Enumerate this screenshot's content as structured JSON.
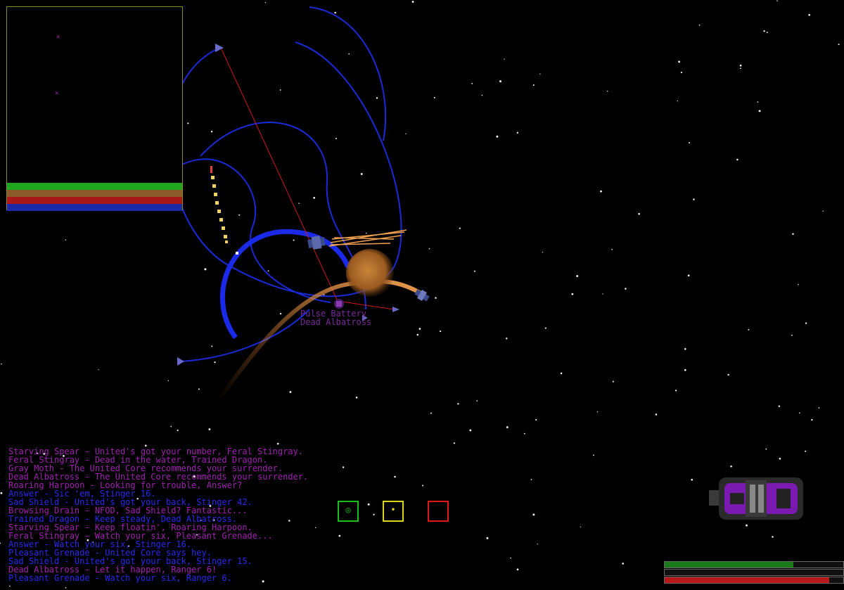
{
  "target": {
    "name": "Pulse Battery",
    "owner": "Dead Albatross"
  },
  "minimap": {
    "bar_colors": [
      "#1fa51f",
      "#8a5a2a",
      "#a81818",
      "#1c2aa8"
    ]
  },
  "chat": [
    {
      "text": "Starving Spear - United's got your number, Feral Stingray.",
      "color": "#a020b0"
    },
    {
      "text": "Feral Stingray - Dead in the water, Trained Dragon.",
      "color": "#a020b0"
    },
    {
      "text": "Gray Moth - The United Core recommends your surrender.",
      "color": "#a020b0"
    },
    {
      "text": "Dead Albatross - The United Core recommends your surrender.",
      "color": "#a020b0"
    },
    {
      "text": "Roaring Harpoon - Looking for trouble, Answer?",
      "color": "#a020b0"
    },
    {
      "text": "Answer - Sic 'em, Stinger 16.",
      "color": "#2a2af0"
    },
    {
      "text": "Sad Shield - United's got your back, Stinger 42.",
      "color": "#2a2af0"
    },
    {
      "text": "Browsing Drain - NFOD, Sad Shield? Fantastic...",
      "color": "#a020b0"
    },
    {
      "text": "Trained Dragon - Keep steady, Dead Albatross.",
      "color": "#2a2af0"
    },
    {
      "text": "Starving Spear - Keep floatin', Roaring Harpoon.",
      "color": "#a020b0"
    },
    {
      "text": "Feral Stingray - Watch your six, Pleasant Grenade...",
      "color": "#a020b0"
    },
    {
      "text": "Answer - Watch your six, Stinger 16.",
      "color": "#2a2af0"
    },
    {
      "text": "Pleasant Grenade - United Core says hey.",
      "color": "#2a2af0"
    },
    {
      "text": "Sad Shield - United's got your back, Stinger 15.",
      "color": "#2a2af0"
    },
    {
      "text": "Dead Albatross - Let it happen, Ranger 6!",
      "color": "#a020b0"
    },
    {
      "text": "Pleasant Grenade - Watch your six, Ranger 6.",
      "color": "#2a2af0"
    }
  ],
  "weapon_slots": [
    {
      "icon": "gun-turret-icon",
      "color": "#18c018",
      "mark": "◎"
    },
    {
      "icon": "missile-launcher-icon",
      "color": "#d8d818",
      "mark": "•"
    },
    {
      "icon": "empty-slot-icon",
      "color": "#e01818",
      "mark": ""
    }
  ],
  "status_bars": [
    {
      "name": "shield",
      "color": "#1a7a1a",
      "level": 0.72
    },
    {
      "name": "energy",
      "color": "#1a1a1a",
      "level": 0.0
    },
    {
      "name": "hull",
      "color": "#b81818",
      "level": 0.92
    }
  ]
}
